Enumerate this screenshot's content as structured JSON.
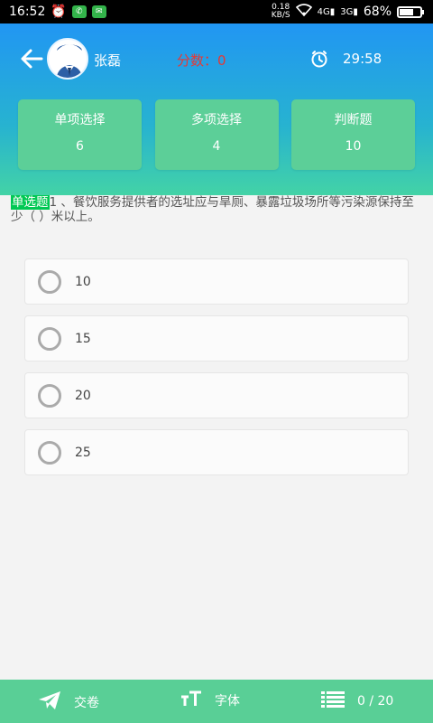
{
  "status_bar": {
    "time": "16:52",
    "net_speed_value": "0.18",
    "net_speed_unit": "KB/S",
    "sig1": "4G",
    "sig2": "3G",
    "battery": "68%",
    "battery_level": 0.68
  },
  "header": {
    "username": "张磊",
    "score": "分数：0",
    "timer": "29:58"
  },
  "categories": [
    {
      "label": "单项选择",
      "count": "6"
    },
    {
      "label": "多项选择",
      "count": "4"
    },
    {
      "label": "判断题",
      "count": "10"
    }
  ],
  "question": {
    "type_tag": "单选题",
    "text": "1 、餐饮服务提供者的选址应与旱厕、暴露垃圾场所等污染源保持至少（    ）米以上。"
  },
  "options": [
    {
      "label": "10"
    },
    {
      "label": "15"
    },
    {
      "label": "20"
    },
    {
      "label": "25"
    }
  ],
  "bottom_bar": {
    "submit_label": "交卷",
    "font_label": "字体",
    "progress": "0 / 20"
  }
}
